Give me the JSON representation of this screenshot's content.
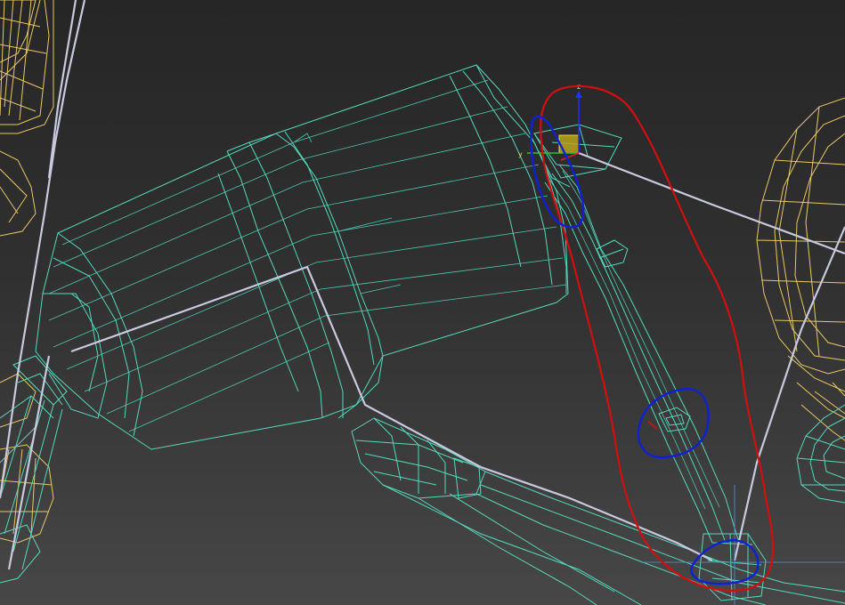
{
  "viewport": {
    "name": "3d-wireframe-viewport"
  },
  "gizmo": {
    "axis_z": "z",
    "axis_y": "y",
    "colors": {
      "x": "#e02020",
      "y": "#30c030",
      "z": "#2030ff",
      "plane": "#b8a41c"
    }
  },
  "colors": {
    "selected_wire": "#56d8bc",
    "unselected_wire": "#e9c865",
    "bone": "#c9c9df",
    "annotation_red": "#d40e0e",
    "annotation_blue": "#1020d4"
  }
}
